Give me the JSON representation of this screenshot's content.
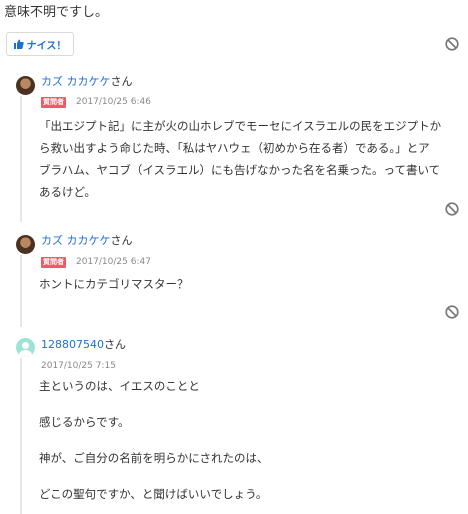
{
  "top": {
    "text": "意味不明ですし。"
  },
  "nice_button": {
    "label": "ナイス！"
  },
  "comments": [
    {
      "author": "カズ カカケケ",
      "author_suffix": "さん",
      "badge": "質問者",
      "time": "2017/10/25 6:46",
      "lines": [
        "「出エジプト記」に主が火の山ホレブでモーセにイスラエルの民をエジプトか",
        "ら救い出すよう命じた時、「私はヤハウェ（初めから在る者）である。」とア",
        "ブラハム、ヤコブ（イスラエル）にも告げなかった名を名乗った。って書いて",
        "あるけど。"
      ]
    },
    {
      "author": "カズ カカケケ",
      "author_suffix": "さん",
      "badge": "質問者",
      "time": "2017/10/25 6:47",
      "lines": [
        "ホントにカテゴリマスター？"
      ]
    },
    {
      "author": "128807540",
      "author_suffix": "さん",
      "time": "2017/10/25 7:15",
      "paragraphs": [
        "主というのは、イエスのことと",
        "感じるからです。",
        "神が、ご自分の名前を明らかにされたのは、",
        "どこの聖句ですか、と聞けばいいでしょう。"
      ]
    }
  ],
  "colors": {
    "link": "#1f6fd0",
    "badge": "#ee5a66",
    "avatar_user": "#9ee3d6"
  }
}
